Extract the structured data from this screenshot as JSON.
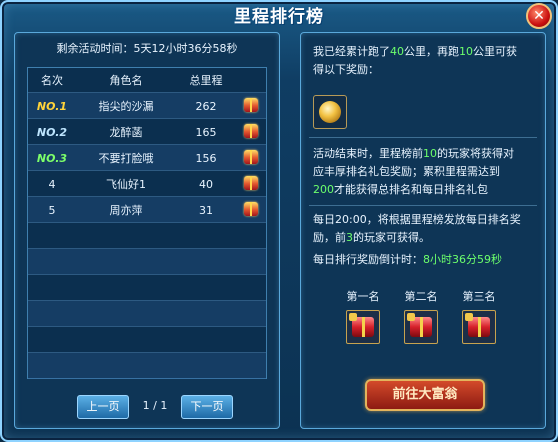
{
  "window": {
    "title": "里程排行榜",
    "close_symbol": "✕"
  },
  "left": {
    "remaining_label": "剩余活动时间：5天12小时36分58秒",
    "columns": [
      "名次",
      "角色名",
      "总里程"
    ],
    "rows": [
      {
        "rank": "NO.1",
        "name": "指尖的沙漏",
        "distance": "262"
      },
      {
        "rank": "NO.2",
        "name": "龙醉菡",
        "distance": "165"
      },
      {
        "rank": "NO.3",
        "name": "不要打脸哦",
        "distance": "156"
      },
      {
        "rank": "4",
        "name": "飞仙好1",
        "distance": "40"
      },
      {
        "rank": "5",
        "name": "周亦萍",
        "distance": "31"
      }
    ],
    "prev_label": "上一页",
    "page_indicator": "1 / 1",
    "next_label": "下一页"
  },
  "right": {
    "progress_line1_pre": "我已经累计跑了",
    "progress_run": "40",
    "progress_line1_mid": "公里，再跑",
    "progress_remaining": "10",
    "progress_line1_post": "公里可获",
    "progress_line2": "得以下奖励：",
    "end_text_1_pre": "活动结束时，里程榜前",
    "end_top_n": "10",
    "end_text_1_post": "的玩家将获得对",
    "end_text_2": "应丰厚排名礼包奖励；累积里程需达到",
    "end_min_distance": "200",
    "end_text_3_post": "才能获得总排名和每日排名礼包",
    "daily_text_1": "每日20:00，将根据里程榜发放每日排名奖",
    "daily_text_2_pre": "励，前",
    "daily_top_n": "3",
    "daily_text_2_post": "的玩家可获得。",
    "countdown_label": "每日排行奖励倒计时：",
    "countdown_value": "8小时36分59秒",
    "rank_rewards": [
      "第一名",
      "第二名",
      "第三名"
    ],
    "go_button": "前往大富翁"
  },
  "colors": {
    "highlight_green": "#6cff6c",
    "rank1": "#ffd43a",
    "rank2": "#bfe6ff",
    "rank3": "#7dff6a"
  }
}
